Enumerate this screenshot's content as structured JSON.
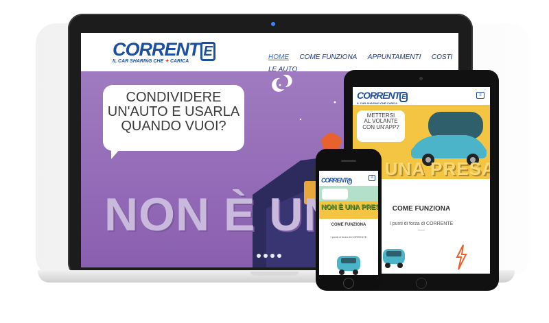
{
  "brand": {
    "name": "CORRENTE",
    "logo_main": "CORRENT",
    "logo_e": "E",
    "tagline": "IL CAR SHARING CHE",
    "tagline_end": "CARICA",
    "primary_color": "#1d4fa0",
    "accent_color": "#e63a2e"
  },
  "laptop": {
    "nav": [
      {
        "label": "HOME",
        "active": true
      },
      {
        "label": "COME FUNZIONA",
        "active": false
      },
      {
        "label": "APPUNTAMENTI",
        "active": false
      },
      {
        "label": "COSTI",
        "active": false
      },
      {
        "label": "LE AUTO",
        "active": false
      }
    ],
    "hero": {
      "bubble_lines": [
        "CONDIVIDERE",
        "UN'AUTO E USARLA",
        "QUANDO VUOI?"
      ],
      "big_text": "NON È UNA",
      "background": "#9a74bd",
      "slider_dots": 4
    }
  },
  "tablet": {
    "menu_icon": "hamburger-icon",
    "hero": {
      "bubble_lines": [
        "METTERSI",
        "AL VOLANTE",
        "CON UN'APP?"
      ],
      "big_text": "È UNA PRESA!",
      "background": "#f4c542"
    },
    "section_title": "COME FUNZIONA",
    "section_subtitle": "I punti di forza di CORRENTE"
  },
  "phone": {
    "menu_icon": "hamburger-icon",
    "hero": {
      "big_text": "NON È UNA PRESA"
    },
    "section_title": "COME FUNZIONA",
    "section_subtitle": "I punti di forza di CORRENTE"
  }
}
